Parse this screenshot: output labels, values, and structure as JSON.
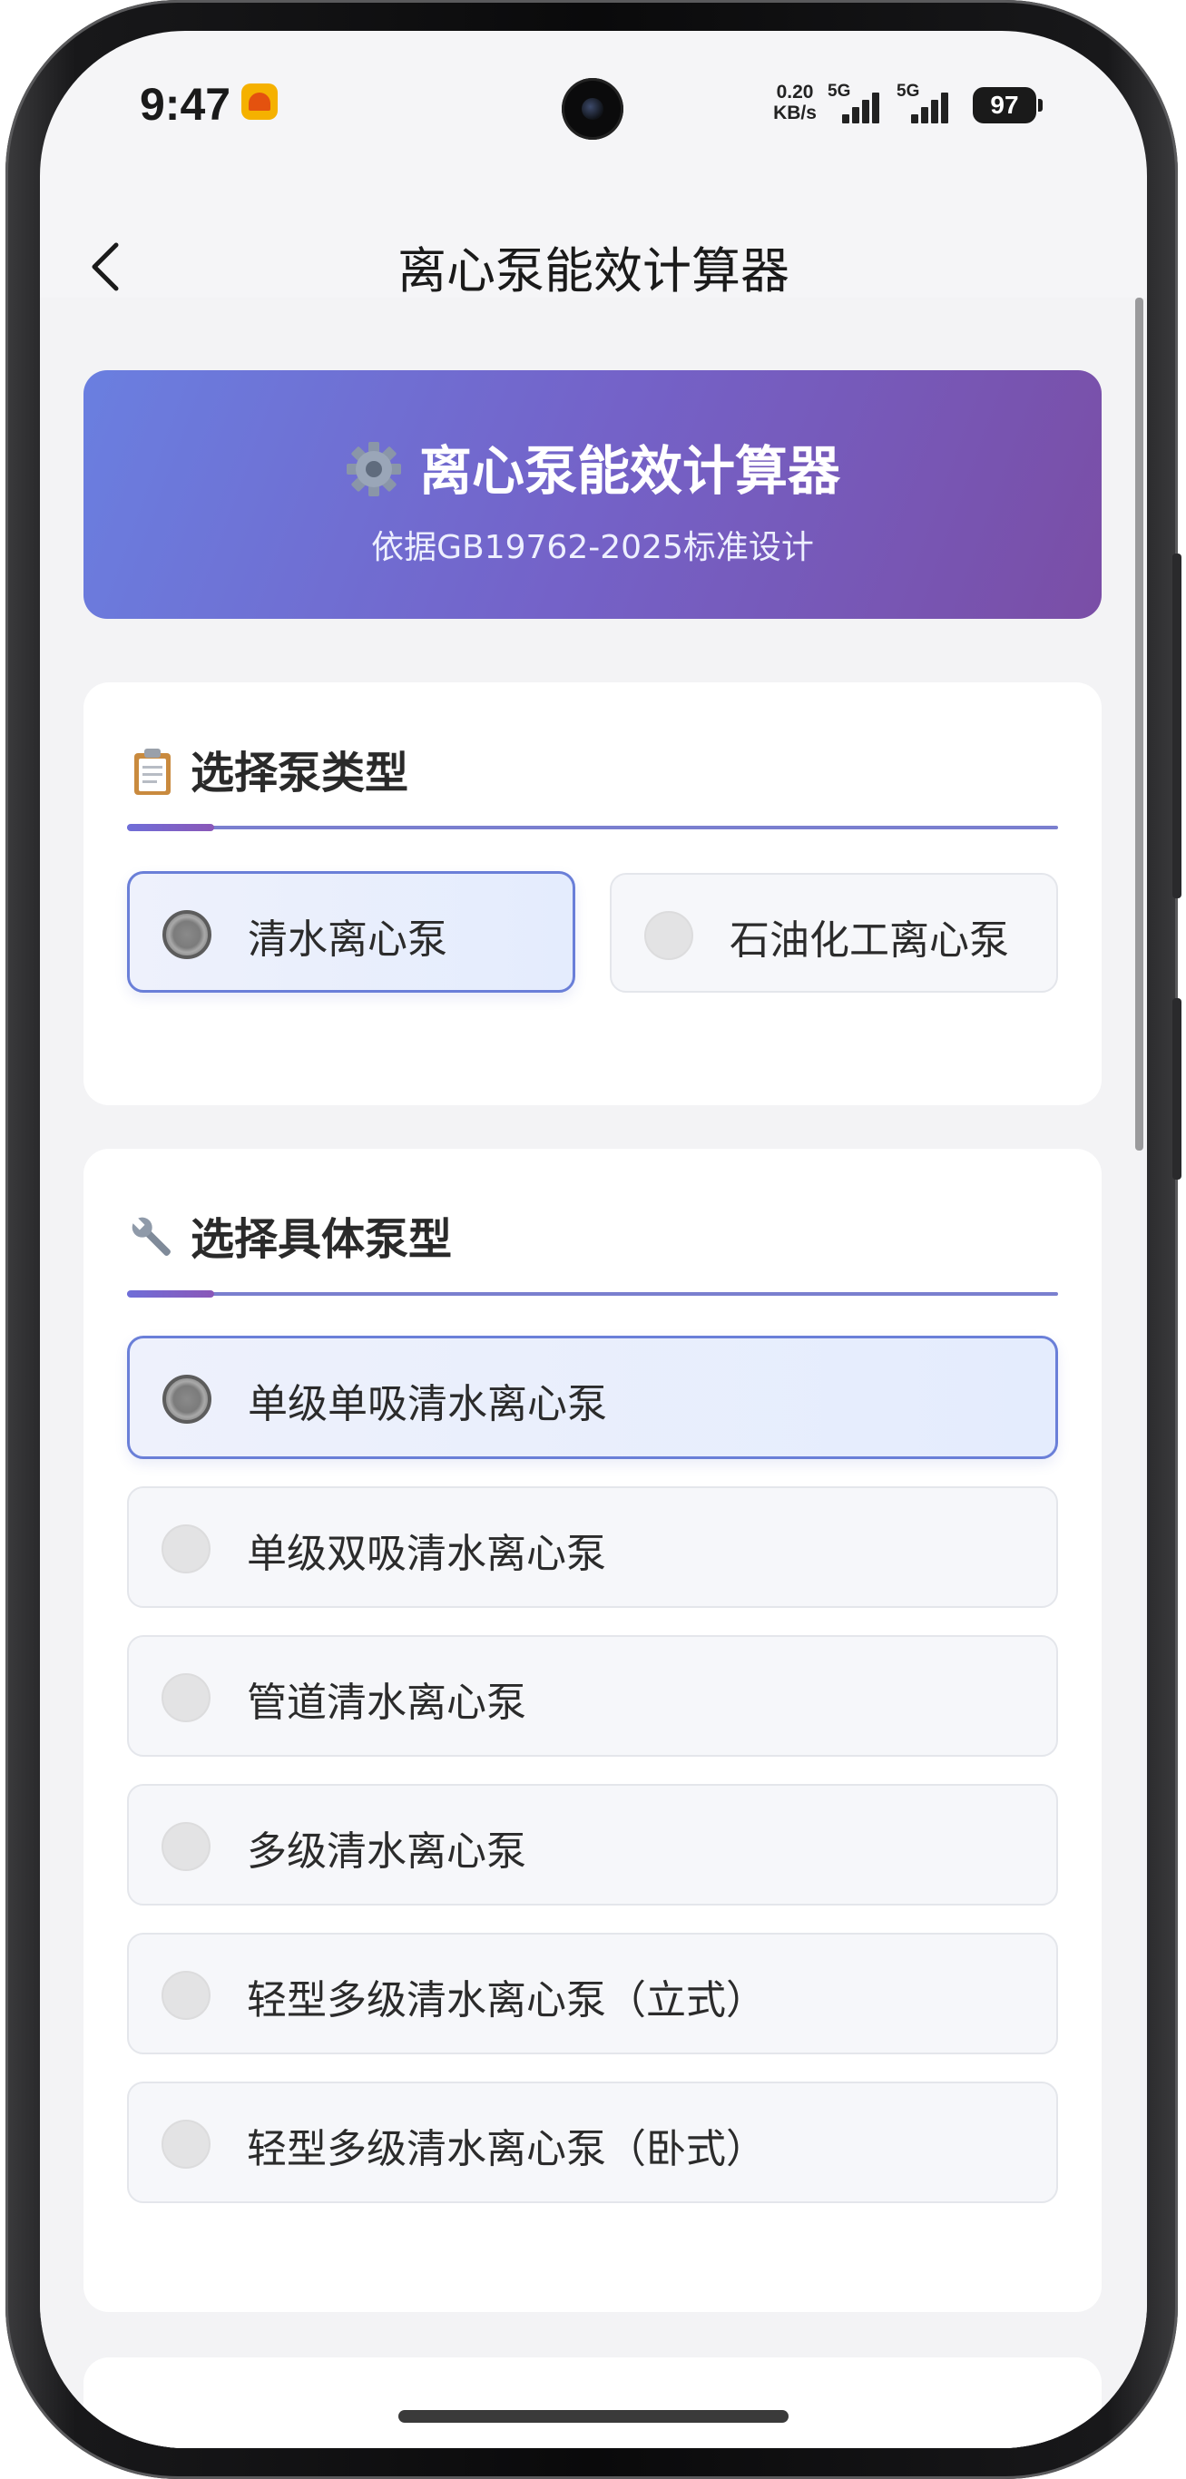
{
  "status_bar": {
    "time": "9:47",
    "net_speed": "0.20",
    "net_unit": "KB/s",
    "sim1": "5G",
    "sim2": "5G",
    "battery": "97"
  },
  "nav": {
    "title": "离心泵能效计算器"
  },
  "banner": {
    "icon": "gear-icon",
    "title": "离心泵能效计算器",
    "subtitle": "依据GB19762-2025标准设计",
    "gradient": [
      "#6a7fe0",
      "#7a4ea6"
    ]
  },
  "pump_category": {
    "icon": "clipboard-icon",
    "title": "选择泵类型",
    "options": [
      {
        "label": "清水离心泵",
        "selected": true
      },
      {
        "label": "石油化工离心泵",
        "selected": false
      }
    ]
  },
  "pump_model": {
    "icon": "wrench-icon",
    "title": "选择具体泵型",
    "options": [
      {
        "label": "单级单吸清水离心泵",
        "selected": true
      },
      {
        "label": "单级双吸清水离心泵",
        "selected": false
      },
      {
        "label": "管道清水离心泵",
        "selected": false
      },
      {
        "label": "多级清水离心泵",
        "selected": false
      },
      {
        "label": "轻型多级清水离心泵（立式）",
        "selected": false
      },
      {
        "label": "轻型多级清水离心泵（卧式）",
        "selected": false
      }
    ]
  },
  "colors": {
    "accent": "#6a7fd8",
    "selected_bg": "#e8eefc",
    "page_bg": "#f3f3f5"
  }
}
